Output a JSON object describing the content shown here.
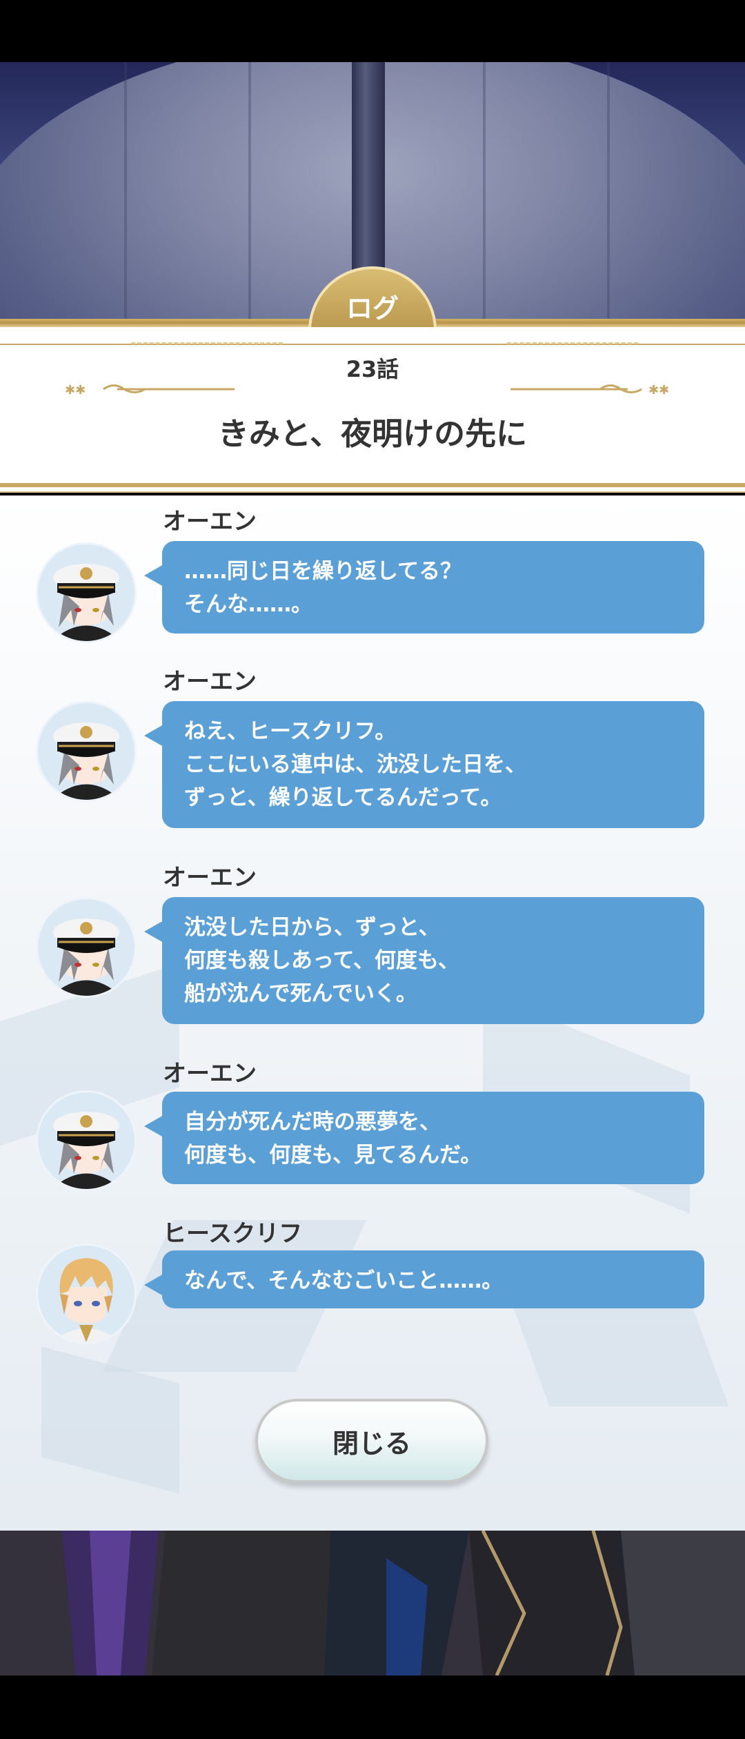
{
  "header": {
    "tab_label": "ログ",
    "episode": "23話",
    "title": "きみと、夜明けの先に"
  },
  "entries": [
    {
      "speaker": "オーエン",
      "avatar": "owen-avatar",
      "text": "……同じ日を繰り返してる？\nそんな……。"
    },
    {
      "speaker": "オーエン",
      "avatar": "owen-avatar",
      "text": "ねえ、ヒースクリフ。\nここにいる連中は、沈没した日を、\nずっと、繰り返してるんだって。"
    },
    {
      "speaker": "オーエン",
      "avatar": "owen-avatar",
      "text": "沈没した日から、ずっと、\n何度も殺しあって、何度も、\n船が沈んで死んでいく。"
    },
    {
      "speaker": "オーエン",
      "avatar": "owen-avatar",
      "text": "自分が死んだ時の悪夢を、\n何度も、何度も、見てるんだ。"
    },
    {
      "speaker": "ヒースクリフ",
      "avatar": "heathcliff-avatar",
      "text": "なんで、そんなむごいこと……。"
    }
  ],
  "close_button": {
    "label": "閉じる"
  },
  "colors": {
    "bubble": "#5b9fd7",
    "gold": "#c7a763",
    "text": "#333333"
  }
}
